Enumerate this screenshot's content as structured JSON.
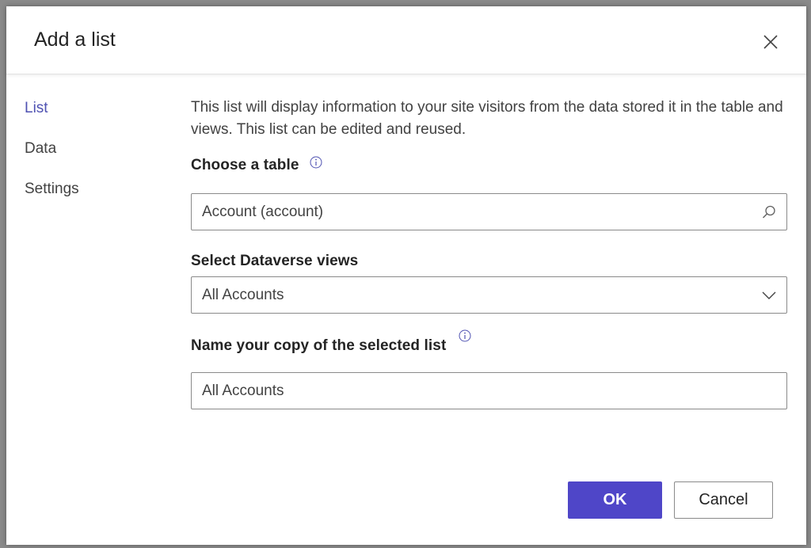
{
  "dialog": {
    "title": "Add a list"
  },
  "nav": {
    "items": [
      {
        "label": "List",
        "active": true
      },
      {
        "label": "Data",
        "active": false
      },
      {
        "label": "Settings",
        "active": false
      }
    ]
  },
  "form": {
    "description": "This list will display information to your site visitors from the data stored it in the table and views. This list can be edited and reused.",
    "table_label": "Choose a table",
    "table_value": "Account (account)",
    "views_label": "Select Dataverse views",
    "views_value": "All Accounts",
    "name_label": "Name your copy of the selected list",
    "name_value": "All Accounts"
  },
  "buttons": {
    "ok_label": "OK",
    "cancel_label": "Cancel"
  },
  "icons": {
    "close": "close-icon",
    "info": "info-icon",
    "search": "search-icon",
    "dropdown": "chevron-down-icon"
  },
  "colors": {
    "accent": "#4f46c8",
    "nav_active": "#4f52b2",
    "info_icon": "#4f52b2"
  }
}
